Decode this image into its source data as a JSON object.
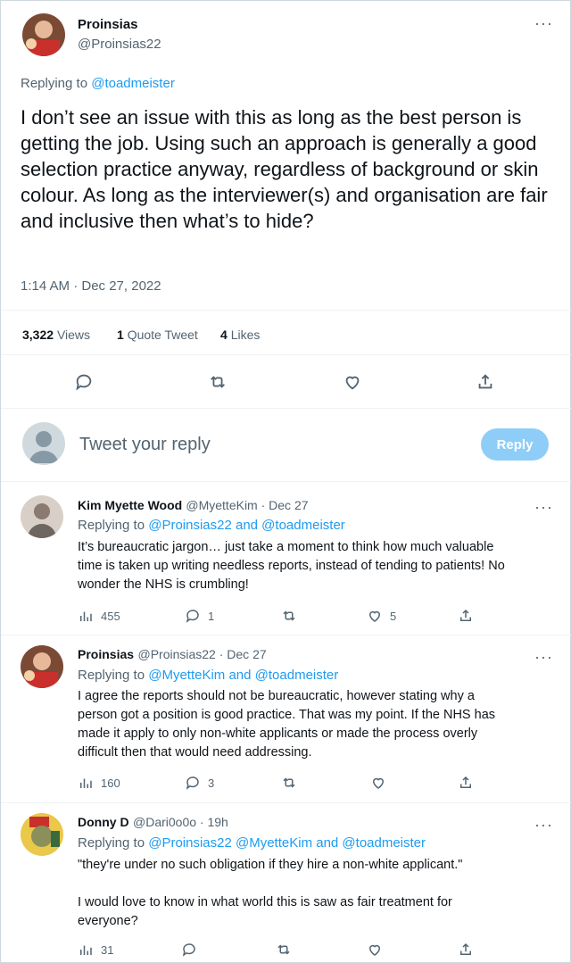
{
  "main_tweet": {
    "author_name": "Proinsias",
    "author_handle": "@Proinsias22",
    "replying_prefix": "Replying to",
    "replying_to": "@toadmeister",
    "text": "I don’t see an issue with this as long as the best person is getting the job. Using such an approach is generally a good selection practice anyway, regardless of background or skin colour. As long as the interviewer(s) and organisation are fair and inclusive then what’s to hide?",
    "timestamp": "1:14 AM · Dec 27, 2022",
    "views_count": "3,322",
    "views_label": "Views",
    "quote_count": "1",
    "quote_label": "Quote Tweet",
    "likes_count": "4",
    "likes_label": "Likes"
  },
  "composer": {
    "placeholder": "Tweet your reply",
    "button_label": "Reply"
  },
  "replies": [
    {
      "author_name": "Kim Myette Wood",
      "meta": "@MyetteKim · Dec 27",
      "replying_prefix": "Replying to",
      "replying_to": "@Proinsias22 and @toadmeister",
      "lines": [
        "It’s bureaucratic jargon… just take a moment to think how much valuable",
        "time is taken up writing needless reports, instead of tending to patients! No",
        "wonder the NHS is crumbling!"
      ],
      "views": "455",
      "replies": "1",
      "retweets": "",
      "likes": "5"
    },
    {
      "author_name": "Proinsias",
      "meta": "@Proinsias22 · Dec 27",
      "replying_prefix": "Replying to",
      "replying_to": "@MyetteKim and @toadmeister",
      "lines": [
        "I agree the reports should not be bureaucratic, however stating why a",
        "person got a position is good practice. That was my point. If the NHS has",
        "made it apply to only non-white applicants or made the process overly",
        "difficult then that would need addressing."
      ],
      "views": "160",
      "replies": "3",
      "retweets": "",
      "likes": ""
    },
    {
      "author_name": "Donny D",
      "meta": "@Dari0o0o · 19h",
      "replying_prefix": "Replying to",
      "replying_to": "@Proinsias22 @MyetteKim and @toadmeister",
      "lines": [
        "\"they're under no such obligation if they hire a non-white applicant.\"",
        "",
        "I would love to know in what world this is saw as fair treatment for",
        "everyone?"
      ],
      "views": "31",
      "replies": "",
      "retweets": "",
      "likes": ""
    }
  ],
  "colors": {
    "accent": "#1d9bf0",
    "reply_button_disabled": "#8ecdf8",
    "secondary_text": "#536471"
  }
}
